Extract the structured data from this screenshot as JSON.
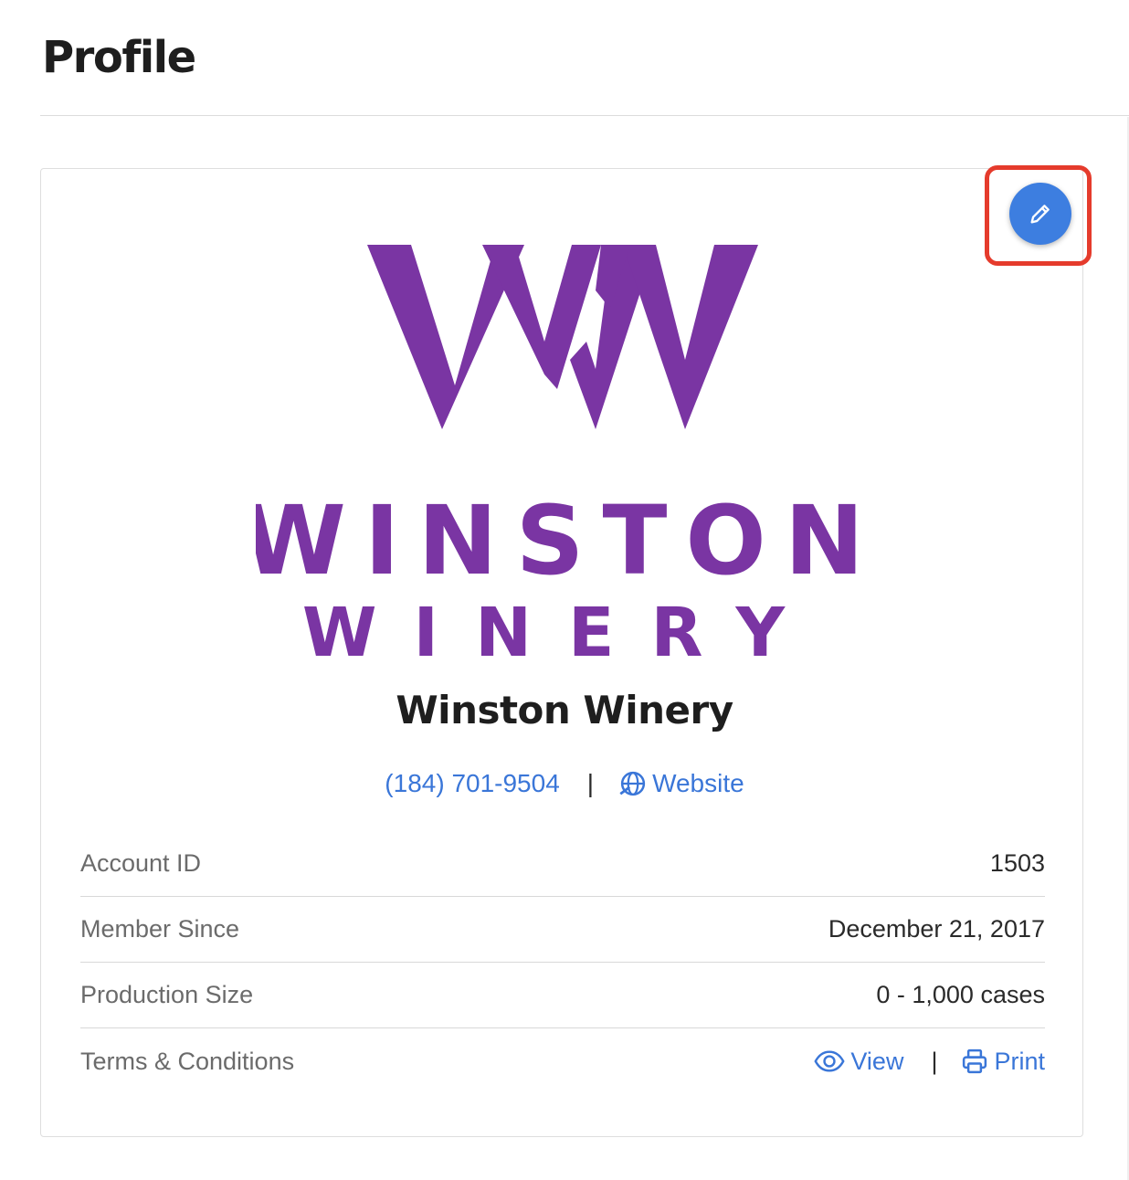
{
  "page": {
    "title": "Profile"
  },
  "profile": {
    "logo_text": "WINSTON WINERY",
    "name": "Winston Winery",
    "phone": "(184) 701-9504",
    "website_label": "Website",
    "edit_icon": "pencil-icon",
    "website_icon": "globe-icon"
  },
  "details": {
    "account_id": {
      "label": "Account ID",
      "value": "1503"
    },
    "member_since": {
      "label": "Member Since",
      "value": "December 21, 2017"
    },
    "production_size": {
      "label": "Production Size",
      "value": "0 - 1,000 cases"
    },
    "terms": {
      "label": "Terms & Conditions",
      "view_label": "View",
      "print_label": "Print",
      "view_icon": "eye-icon",
      "print_icon": "printer-icon"
    }
  },
  "colors": {
    "brand_purple": "#7a35a3",
    "link_blue": "#3a76d8",
    "edit_button": "#3d7ee0",
    "highlight_red": "#e53b2c"
  }
}
